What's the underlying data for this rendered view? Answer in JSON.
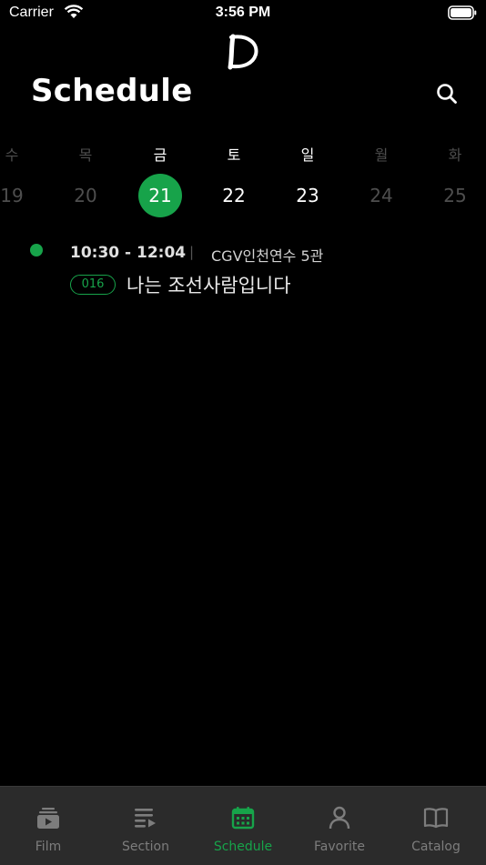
{
  "status_bar": {
    "carrier": "Carrier",
    "time": "3:56 PM"
  },
  "header": {
    "title": "Schedule"
  },
  "week": [
    {
      "weekday": "수",
      "date": "19",
      "state": "dim"
    },
    {
      "weekday": "목",
      "date": "20",
      "state": "dim"
    },
    {
      "weekday": "금",
      "date": "21",
      "state": "selected"
    },
    {
      "weekday": "토",
      "date": "22",
      "state": "active"
    },
    {
      "weekday": "일",
      "date": "23",
      "state": "active"
    },
    {
      "weekday": "월",
      "date": "24",
      "state": "dim"
    },
    {
      "weekday": "화",
      "date": "25",
      "state": "dim"
    }
  ],
  "events": [
    {
      "time_range": "10:30 - 12:04",
      "separator": "|",
      "venue": "CGV인천연수 5관",
      "code": "016",
      "title": "나는 조선사람입니다"
    }
  ],
  "tabs": [
    {
      "label": "Film",
      "icon": "film-icon"
    },
    {
      "label": "Section",
      "icon": "section-icon"
    },
    {
      "label": "Schedule",
      "icon": "calendar-icon",
      "selected": true
    },
    {
      "label": "Favorite",
      "icon": "person-icon"
    },
    {
      "label": "Catalog",
      "icon": "book-icon"
    }
  ],
  "colors": {
    "accent": "#17a34a",
    "background": "#000000",
    "tab_bar": "#2b2b2b",
    "dim_text": "#4e4e4e",
    "inactive_tab": "#7d7d7d"
  }
}
